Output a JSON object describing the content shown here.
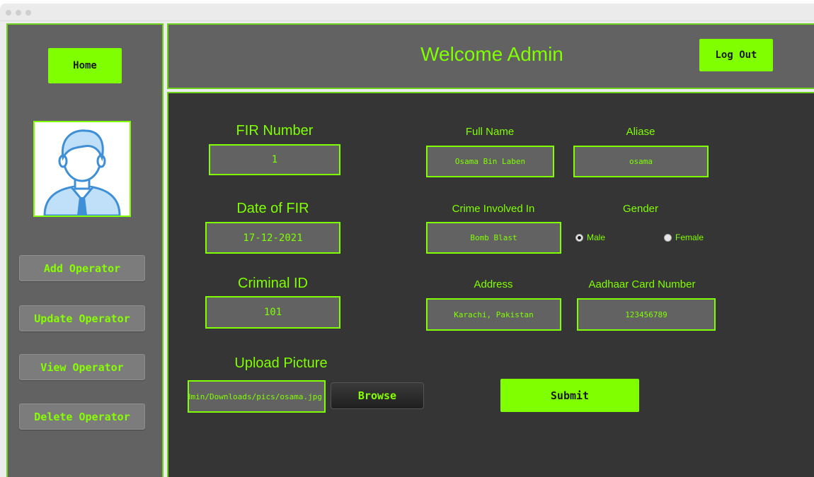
{
  "sidebar": {
    "home_label": "Home",
    "items": [
      {
        "label": "Add Operator"
      },
      {
        "label": "Update Operator"
      },
      {
        "label": "View Operator"
      },
      {
        "label": "Delete Operator"
      }
    ]
  },
  "header": {
    "welcome": "Welcome Admin",
    "logout_label": "Log Out"
  },
  "form": {
    "fir_number": {
      "label": "FIR Number",
      "value": "1"
    },
    "date_of_fir": {
      "label": "Date of FIR",
      "value": "17-12-2021"
    },
    "criminal_id": {
      "label": "Criminal ID",
      "value": "101"
    },
    "upload_picture": {
      "label": "Upload Picture",
      "value": "/Users/admin/Downloads/pics/osama.jpg",
      "browse_label": "Browse"
    },
    "full_name": {
      "label": "Full Name",
      "value": "Osama Bin Laben"
    },
    "aliase": {
      "label": "Aliase",
      "value": "osama"
    },
    "crime": {
      "label": "Crime Involved In",
      "value": "Bomb Blast"
    },
    "gender": {
      "label": "Gender",
      "options": [
        "Male",
        "Female"
      ],
      "selected": "Male"
    },
    "address": {
      "label": "Address",
      "value": "Karachi, Pakistan"
    },
    "aadhaar": {
      "label": "Aadhaar Card Number",
      "value": "123456789"
    },
    "submit_label": "Submit"
  },
  "colors": {
    "accent": "#7fff00",
    "panel": "#626262",
    "main_bg": "#353535"
  }
}
